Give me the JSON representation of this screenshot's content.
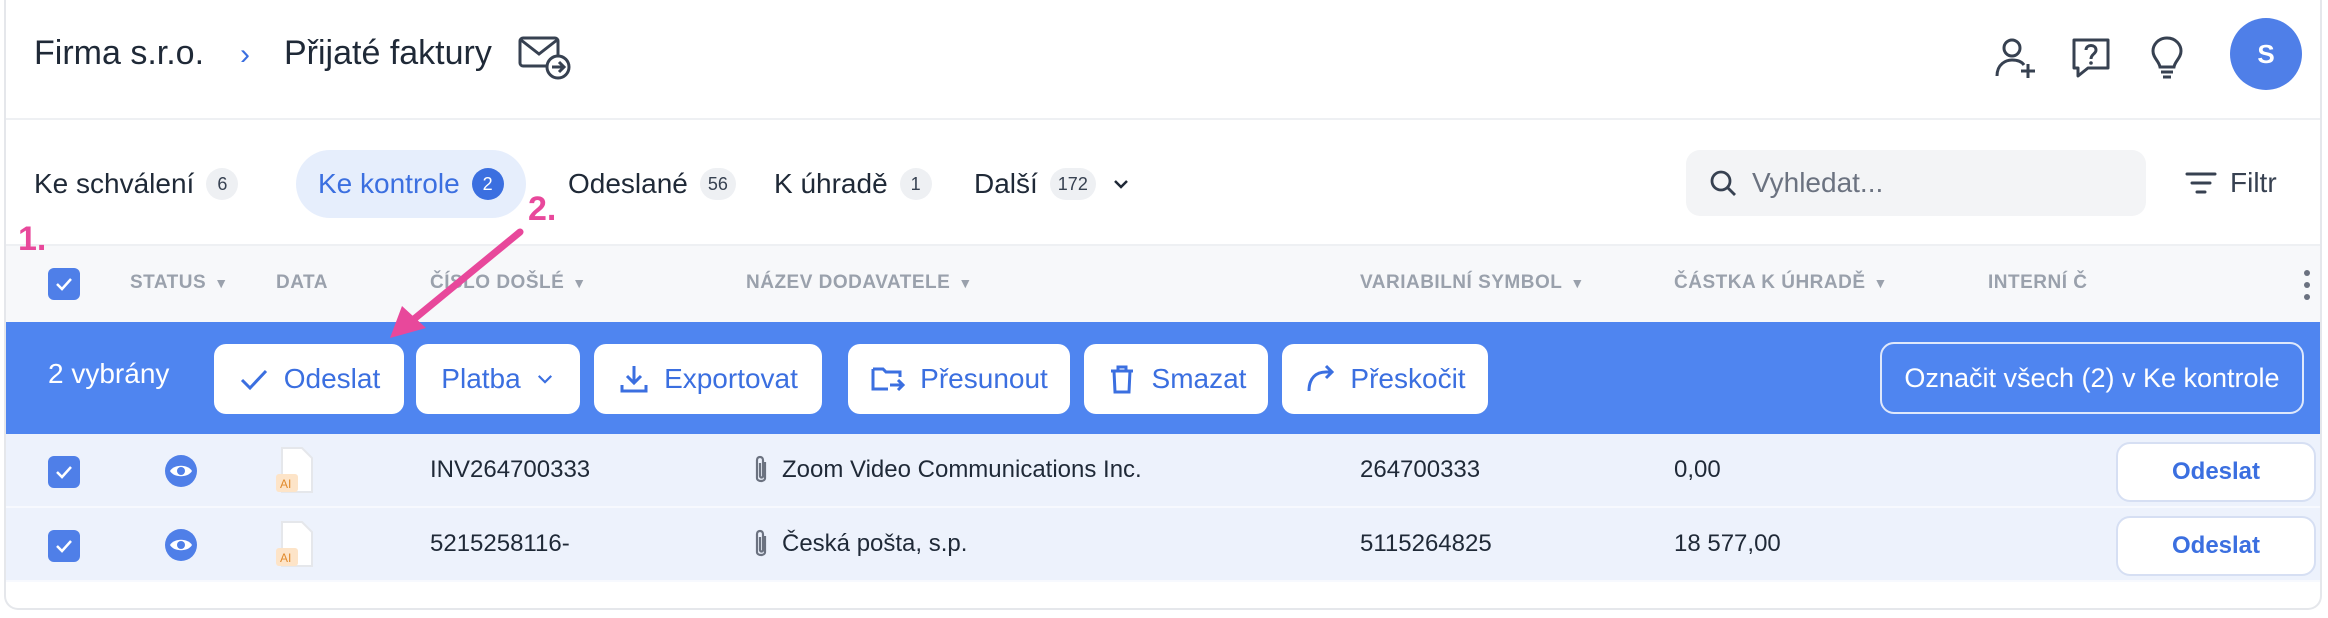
{
  "header": {
    "company": "Firma s.r.o.",
    "separator": "›",
    "page_title": "Přijaté faktury",
    "avatar_initial": "S"
  },
  "tabs": [
    {
      "label": "Ke schválení",
      "count": "6"
    },
    {
      "label": "Ke kontrole",
      "count": "2",
      "active": true
    },
    {
      "label": "Odeslané",
      "count": "56"
    },
    {
      "label": "K úhradě",
      "count": "1"
    },
    {
      "label": "Další",
      "count": "172"
    }
  ],
  "search": {
    "placeholder": "Vyhledat..."
  },
  "filter_label": "Filtr",
  "columns": {
    "status": "STATUS",
    "data": "DATA",
    "cislo": "ČÍSLO DOŠLÉ",
    "dodavatel": "NÁZEV DODAVATELE",
    "vs": "VARIABILNÍ SYMBOL",
    "castka": "ČÁSTKA K ÚHRADĚ",
    "interni": "INTERNÍ Č"
  },
  "bulk": {
    "count_label": "2 vybrány",
    "send": "Odeslat",
    "payment": "Platba",
    "export": "Exportovat",
    "move": "Přesunout",
    "delete": "Smazat",
    "skip": "Přeskočit",
    "mark_all": "Označit všech (2) v Ke kontrole"
  },
  "rows": [
    {
      "number": "INV264700333",
      "supplier": "Zoom Video Communications Inc.",
      "vs": "264700333",
      "amount": "0,00",
      "action": "Odeslat",
      "doc_badge": "AI"
    },
    {
      "number": "5215258116-",
      "supplier": "Česká pošta, s.p.",
      "vs": "5115264825",
      "amount": "18 577,00",
      "action": "Odeslat",
      "doc_badge": "AI"
    }
  ],
  "annotations": {
    "step1": "1.",
    "step2": "2."
  },
  "colors": {
    "accent": "#4f7fe8",
    "bulk_bar": "#4f85f0",
    "annotation": "#e8489b",
    "row_bg": "#edf2fc"
  }
}
